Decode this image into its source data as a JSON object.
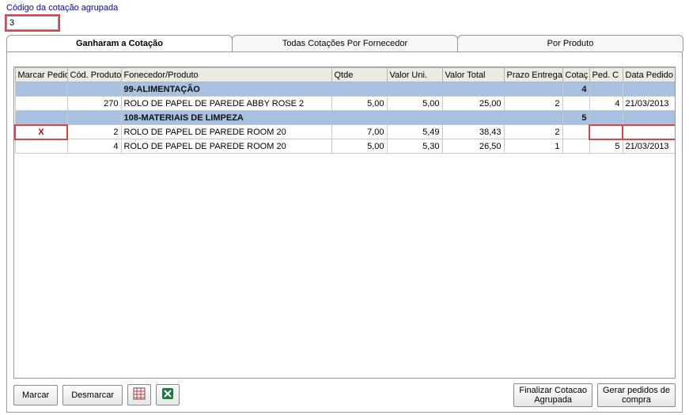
{
  "header": {
    "field_label": "Código da cotação agrupada",
    "field_value": "3"
  },
  "tabs": [
    {
      "label": "Ganharam a Cotação",
      "active": true
    },
    {
      "label": "Todas Cotações Por Fornecedor",
      "active": false
    },
    {
      "label": "Por Produto",
      "active": false
    }
  ],
  "grid": {
    "columns": {
      "marcar": "Marcar Pedido",
      "cod": "Cód. Produto",
      "desc": "Fonecedor/Produto",
      "qtde": "Qtde",
      "vuni": "Valor Uni.",
      "vtot": "Valor Total",
      "prazo": "Prazo Entrega",
      "cotac": "Cotaç",
      "pedc": "Ped. C",
      "data": "Data Pedido"
    },
    "groups": [
      {
        "title": "99-ALIMENTAÇÃO",
        "cotac": "4",
        "rows": [
          {
            "mark": "",
            "cod": "270",
            "desc": "ROLO DE PAPEL DE PAREDE ABBY ROSE 2",
            "qtde": "5,00",
            "vuni": "5,00",
            "vtot": "25,00",
            "prazo": "2",
            "cotac": "",
            "pedc": "4",
            "data": "21/03/2013",
            "hl_mark": false,
            "hl_ped": false
          }
        ]
      },
      {
        "title": "108-MATERIAIS DE LIMPEZA",
        "cotac": "5",
        "rows": [
          {
            "mark": "X",
            "cod": "2",
            "desc": "ROLO DE PAPEL DE PAREDE ROOM 20",
            "qtde": "7,00",
            "vuni": "5,49",
            "vtot": "38,43",
            "prazo": "2",
            "cotac": "",
            "pedc": "",
            "data": "",
            "hl_mark": true,
            "hl_ped": true
          },
          {
            "mark": "",
            "cod": "4",
            "desc": "ROLO DE PAPEL DE PAREDE ROOM 20",
            "qtde": "5,00",
            "vuni": "5,30",
            "vtot": "26,50",
            "prazo": "1",
            "cotac": "",
            "pedc": "5",
            "data": "21/03/2013",
            "hl_mark": false,
            "hl_ped": false
          }
        ]
      }
    ]
  },
  "buttons": {
    "marcar": "Marcar",
    "desmarcar": "Desmarcar",
    "finalizar": "Finalizar Cotacao\nAgrupada",
    "gerar": "Gerar pedidos de\ncompra"
  }
}
